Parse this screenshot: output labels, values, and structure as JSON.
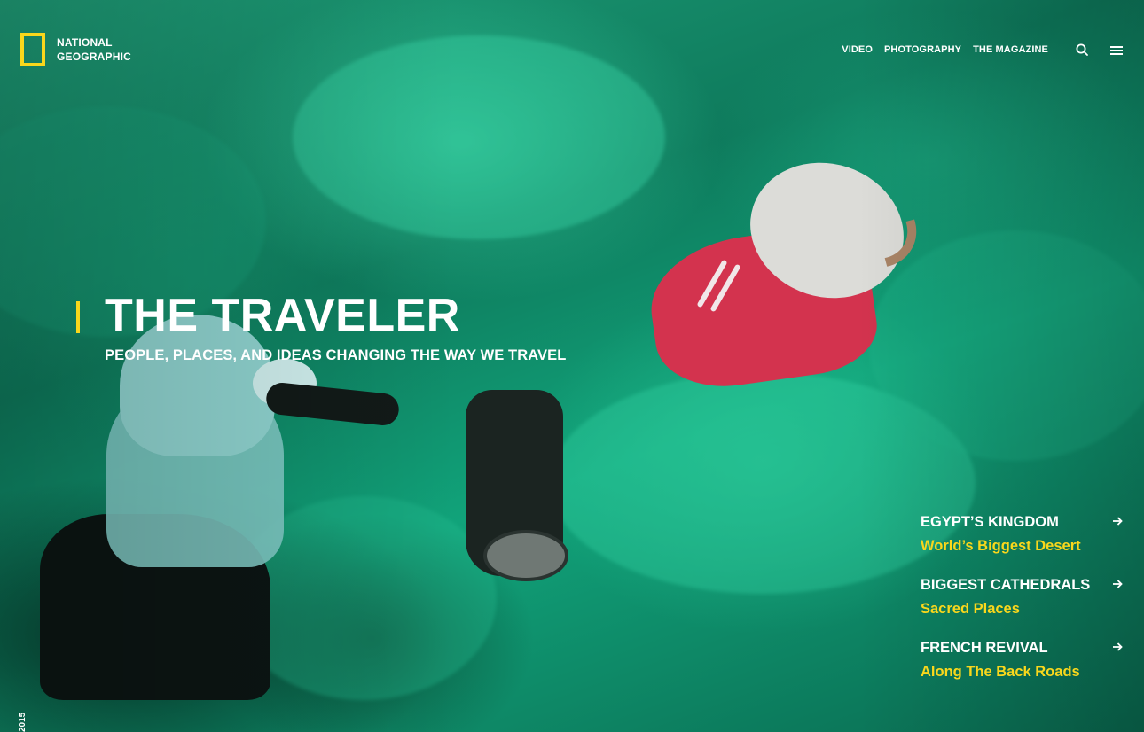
{
  "brand": {
    "name_line1": "NATIONAL",
    "name_line2": "GEOGRAPHIC",
    "accent": "#f9d71c"
  },
  "nav": {
    "items": [
      "VIDEO",
      "PHOTOGRAPHY",
      "THE MAGAZINE"
    ],
    "search_icon": "search-icon",
    "menu_icon": "hamburger-menu-icon"
  },
  "hero": {
    "title": "THE TRAVELER",
    "subtitle": "PEOPLE, PLACES, AND IDEAS CHANGING THE WAY WE TRAVEL"
  },
  "stories": [
    {
      "title": "EGYPT’S KINGDOM",
      "subtitle": "World’s Biggest Desert"
    },
    {
      "title": "BIGGEST CATHEDRALS",
      "subtitle": "Sacred Places"
    },
    {
      "title": "FRENCH REVIVAL",
      "subtitle": "Along The Back Roads"
    }
  ],
  "footer": {
    "year": "2015"
  }
}
